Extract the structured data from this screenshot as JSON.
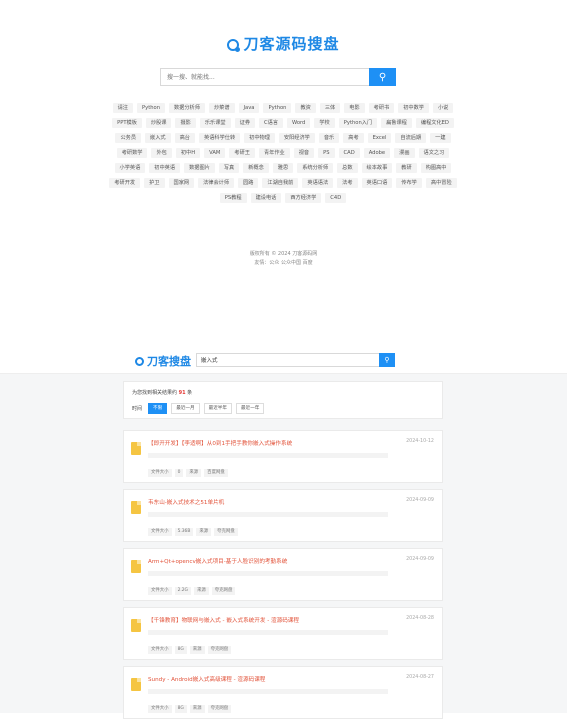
{
  "hero": {
    "logo": "刀客源码搜盘",
    "search_placeholder": "搜一搜、就能找...",
    "search_button_icon": "search-icon"
  },
  "tags": [
    "请注",
    "Python",
    "数据分析师",
    "炒菜谱",
    "Java",
    "Python",
    "教资",
    "三体",
    "电影",
    "考研书",
    "初中数学",
    "小说",
    "PPT模板",
    "炒股课",
    "摄影",
    "乐乐课堂",
    "证券",
    "C语言",
    "Word",
    "学校",
    "Python入门",
    "扁鲁课程",
    "编程文化ED",
    "公务员",
    "嵌入式",
    "高台",
    "英语科学仕转",
    "初中物理",
    "安阳经济学",
    "音乐",
    "高考",
    "Excel",
    "自流后期",
    "一建",
    "考研数学",
    "外包",
    "初中H",
    "VAM",
    "考研王",
    "青年作业",
    "视音",
    "PS",
    "CAD",
    "Adobe",
    "漫画",
    "语文之习",
    "小学英语",
    "初中英语",
    "数据图片",
    "写真",
    "新概念",
    "雅思",
    "系统分析师",
    "总数",
    "绘本故事",
    "教研",
    "构图高中",
    "考研开发",
    "护卫",
    "国家网",
    "法律会计师",
    "园路",
    "江湖自我前",
    "英语语法",
    "法考",
    "英语口语",
    "传布学",
    "高中冒险",
    "PS教程",
    "建设电话",
    "西方经济学",
    "C4D"
  ],
  "footer": {
    "line1": "版权所有 © 2024 刀客源码网",
    "line2": "友情：公众  公众中国  百度"
  },
  "results": {
    "logo": "刀客搜盘",
    "query": "嵌入式",
    "summary_prefix": "为您找到相关结果约",
    "summary_count": "91",
    "summary_suffix": "条",
    "time_label": "时间",
    "filters": [
      "不限",
      "最近一月",
      "最近半年",
      "最近一年"
    ],
    "items": [
      {
        "title": "【即开开发】【李适啊】从0到1手把手教你嵌入式操作系统",
        "date": "2024-10-12",
        "size_label": "文件大小",
        "size": "0",
        "source_label": "来源",
        "source": "百度网盘"
      },
      {
        "title": "韦东山-嵌入式技术之51单片机",
        "date": "2024-09-09",
        "size_label": "文件大小",
        "size": "5.36B",
        "source_label": "来源",
        "source": "夸克网盘"
      },
      {
        "title": "Arm+Qt+opencv嵌入式项目-基于人脸识别的考勤系统",
        "date": "2024-09-09",
        "size_label": "文件大小",
        "size": "2.2G",
        "source_label": "来源",
        "source": "夸克网盘"
      },
      {
        "title": "【千锋教育】物联网与嵌入式 - 嵌入式系统开发 - 渲源码课程",
        "date": "2024-08-28",
        "size_label": "文件大小",
        "size": "8G",
        "source_label": "来源",
        "source": "夸克网盘"
      },
      {
        "title": "Sundy - Android嵌入式高级课程 - 渲源码课程",
        "date": "2024-08-27",
        "size_label": "文件大小",
        "size": "8G",
        "source_label": "来源",
        "source": "夸克网盘"
      }
    ]
  },
  "colors": {
    "brand": "#1e88e5",
    "button": "#1e90f5",
    "title": "#e2533a",
    "count": "#e53935"
  }
}
